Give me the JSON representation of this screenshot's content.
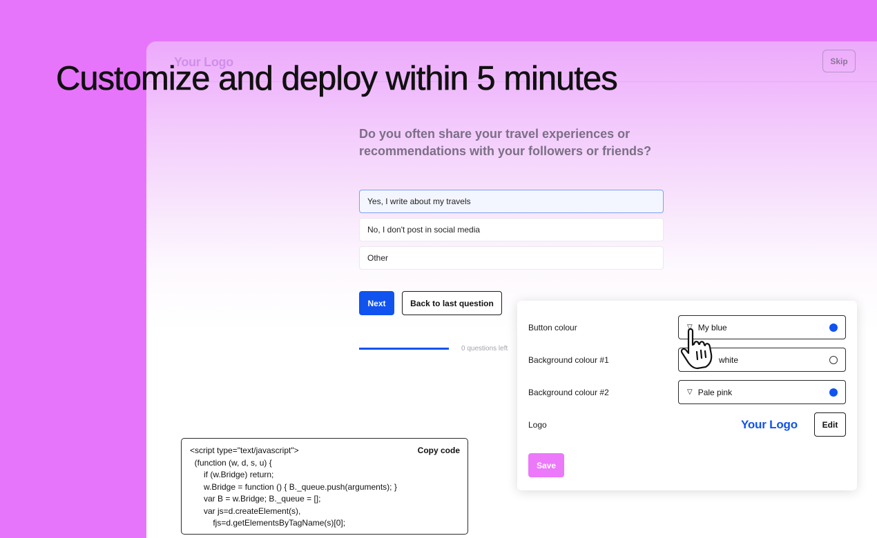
{
  "headline": "Customize and deploy within 5 minutes",
  "app": {
    "logo": "Your Logo",
    "skip_label": "Skip",
    "question": "Do you often share your travel experiences or recommendations with your followers or friends?",
    "options": [
      {
        "label": "Yes, I write about my travels",
        "selected": true
      },
      {
        "label": "No, I don't post in social media",
        "selected": false
      },
      {
        "label": "Other",
        "selected": false
      }
    ],
    "next_label": "Next",
    "back_label": "Back to last question",
    "progress": {
      "fraction": 1.0,
      "text": "0 questions left"
    }
  },
  "settings": {
    "button_colour": {
      "label": "Button colour",
      "value": "My blue",
      "swatch": "#1053ef"
    },
    "background_1": {
      "label": "Background colour #1",
      "value": "white",
      "swatch": "#ffffff"
    },
    "background_2": {
      "label": "Background colour #2",
      "value": "Pale pink",
      "swatch": "#1053ef"
    },
    "logo": {
      "label": "Logo",
      "preview": "Your Logo",
      "edit_label": "Edit"
    },
    "save_label": "Save"
  },
  "code_snippet": {
    "copy_label": "Copy code",
    "code": "<script type=\"text/javascript\">\n  (function (w, d, s, u) {\n      if (w.Bridge) return;\n      w.Bridge = function () { B._queue.push(arguments); }\n      var B = w.Bridge; B._queue = [];\n      var js=d.createElement(s),\n          fjs=d.getElementsByTagName(s)[0];"
  },
  "colors": {
    "page_background": "#e775fb",
    "primary_blue": "#1053ef",
    "save_pink": "#eb79f9"
  }
}
